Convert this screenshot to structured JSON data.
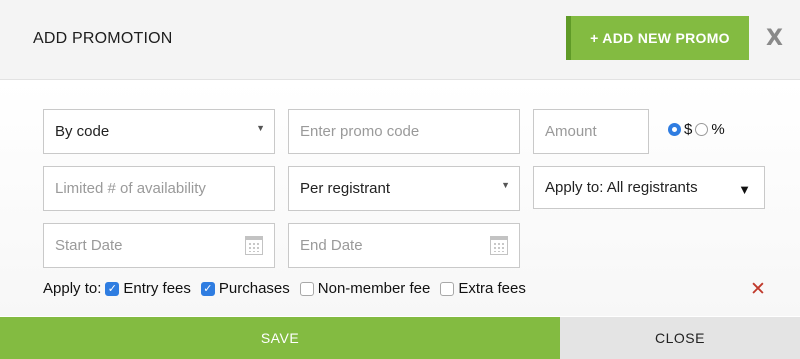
{
  "header": {
    "title": "ADD PROMOTION",
    "add_button_label": "+ ADD NEW PROMO",
    "close_label": "X"
  },
  "form": {
    "promo_type": {
      "value": "By code"
    },
    "promo_code": {
      "placeholder": "Enter promo code"
    },
    "amount": {
      "placeholder": "Amount"
    },
    "amount_unit": {
      "options": [
        {
          "label": "$",
          "checked": true
        },
        {
          "label": "%",
          "checked": false
        }
      ]
    },
    "availability": {
      "placeholder": "Limited # of availability"
    },
    "per_select": {
      "value": "Per registrant"
    },
    "apply_to_select": {
      "value": "Apply to: All registrants"
    },
    "start_date": {
      "placeholder": "Start Date"
    },
    "end_date": {
      "placeholder": "End Date"
    }
  },
  "apply_to": {
    "label": "Apply to:",
    "items": [
      {
        "label": "Entry fees",
        "checked": true
      },
      {
        "label": "Purchases",
        "checked": true
      },
      {
        "label": "Non-member fee",
        "checked": false
      },
      {
        "label": "Extra fees",
        "checked": false
      }
    ],
    "remove_label": "✕"
  },
  "footer": {
    "save_label": "SAVE",
    "close_label": "CLOSE"
  },
  "colors": {
    "accent_green": "#83bb41",
    "checkbox_blue": "#2f7de1",
    "remove_red": "#c0392b"
  }
}
